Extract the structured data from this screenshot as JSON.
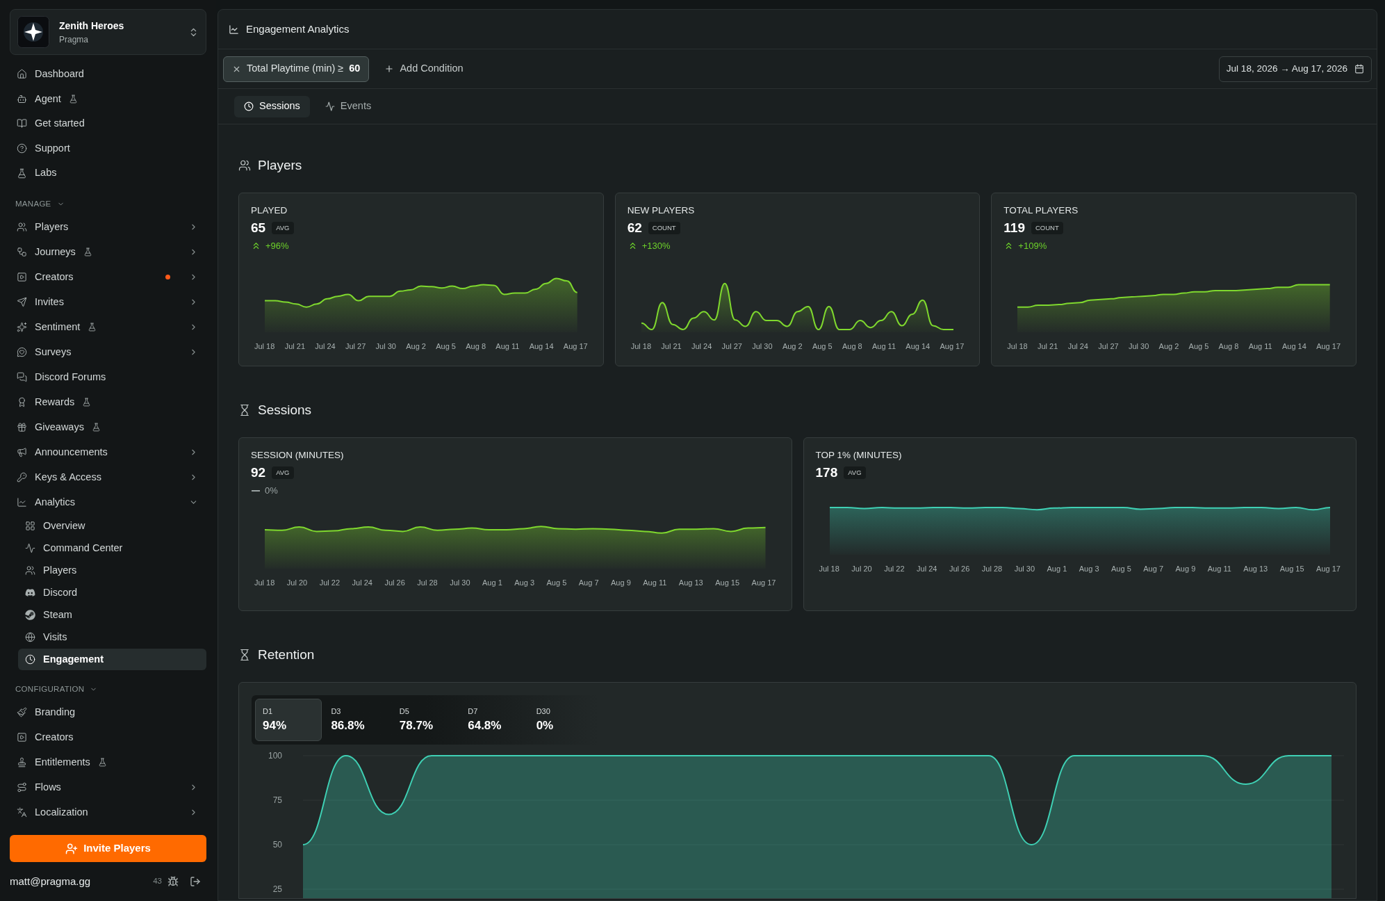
{
  "sidebar": {
    "workspace": {
      "name": "Zenith Heroes",
      "org": "Pragma"
    },
    "items": [
      {
        "label": "Dashboard",
        "beta": false
      },
      {
        "label": "Agent",
        "beta": true
      },
      {
        "label": "Get started",
        "beta": false
      },
      {
        "label": "Support",
        "beta": false
      },
      {
        "label": "Labs",
        "beta": false
      }
    ],
    "sections": [
      {
        "label": "MANAGE",
        "expanded": true,
        "items": [
          {
            "label": "Players",
            "beta": false,
            "notification": false,
            "submenu": true,
            "expanded": false
          },
          {
            "label": "Journeys",
            "beta": true,
            "notification": false,
            "submenu": true,
            "expanded": false
          },
          {
            "label": "Creators",
            "beta": false,
            "notification": true,
            "submenu": true,
            "expanded": false
          },
          {
            "label": "Invites",
            "beta": false,
            "notification": false,
            "submenu": true,
            "expanded": false
          },
          {
            "label": "Sentiment",
            "beta": true,
            "notification": false,
            "submenu": true,
            "expanded": false
          },
          {
            "label": "Surveys",
            "beta": false,
            "notification": false,
            "submenu": true,
            "expanded": false
          },
          {
            "label": "Discord Forums",
            "beta": false,
            "notification": false,
            "submenu": false,
            "expanded": false
          },
          {
            "label": "Rewards",
            "beta": true,
            "notification": false,
            "submenu": false,
            "expanded": false
          },
          {
            "label": "Giveaways",
            "beta": true,
            "notification": false,
            "submenu": false,
            "expanded": false
          },
          {
            "label": "Announcements",
            "beta": false,
            "notification": false,
            "submenu": true,
            "expanded": false
          },
          {
            "label": "Keys & Access",
            "beta": false,
            "notification": false,
            "submenu": true,
            "expanded": false
          },
          {
            "label": "Analytics",
            "beta": false,
            "notification": false,
            "submenu": true,
            "expanded": true,
            "children": [
              {
                "label": "Overview",
                "selected": false
              },
              {
                "label": "Command Center",
                "selected": false
              },
              {
                "label": "Players",
                "selected": false
              },
              {
                "label": "Discord",
                "selected": false
              },
              {
                "label": "Steam",
                "selected": false
              },
              {
                "label": "Visits",
                "selected": false
              },
              {
                "label": "Engagement",
                "selected": true
              }
            ]
          }
        ]
      },
      {
        "label": "CONFIGURATION",
        "expanded": true,
        "items": [
          {
            "label": "Branding",
            "beta": false,
            "notification": false,
            "submenu": false,
            "expanded": false
          },
          {
            "label": "Creators",
            "beta": false,
            "notification": false,
            "submenu": false,
            "expanded": false
          },
          {
            "label": "Entitlements",
            "beta": true,
            "notification": false,
            "submenu": false,
            "expanded": false
          },
          {
            "label": "Flows",
            "beta": false,
            "notification": false,
            "submenu": true,
            "expanded": false
          },
          {
            "label": "Localization",
            "beta": false,
            "notification": false,
            "submenu": true,
            "expanded": false
          }
        ]
      }
    ],
    "invite_button": "Invite Players",
    "user": {
      "email": "matt@pragma.gg",
      "count": "43"
    }
  },
  "header": {
    "title": "Engagement Analytics"
  },
  "filters": {
    "conditions": [
      {
        "label": "Total Playtime (min) ≥",
        "value": "60"
      }
    ],
    "add_button": "Add Condition",
    "date_range": "Jul 18, 2026 → Aug 17, 2026"
  },
  "tabs": [
    {
      "label": "Sessions",
      "selected": true
    },
    {
      "label": "Events",
      "selected": false
    }
  ],
  "sections": [
    {
      "title": "Players",
      "cards": [
        {
          "title": "PLAYED",
          "value": "65",
          "unit": "AVG",
          "color": "#7fd82e",
          "change": {
            "kind": "up",
            "text": "+96%"
          },
          "x_labels": [
            "Jul 18",
            "Jul 21",
            "Jul 24",
            "Jul 27",
            "Jul 30",
            "Aug 2",
            "Aug 5",
            "Aug 8",
            "Aug 11",
            "Aug 14",
            "Aug 17"
          ]
        },
        {
          "title": "NEW PLAYERS",
          "value": "62",
          "unit": "COUNT",
          "color": "#7fd82e",
          "change": {
            "kind": "up",
            "text": "+130%"
          },
          "x_labels": [
            "Jul 18",
            "Jul 21",
            "Jul 24",
            "Jul 27",
            "Jul 30",
            "Aug 2",
            "Aug 5",
            "Aug 8",
            "Aug 11",
            "Aug 14",
            "Aug 17"
          ]
        },
        {
          "title": "TOTAL PLAYERS",
          "value": "119",
          "unit": "COUNT",
          "color": "#7fd82e",
          "change": {
            "kind": "up",
            "text": "+109%"
          },
          "x_labels": [
            "Jul 18",
            "Jul 21",
            "Jul 24",
            "Jul 27",
            "Jul 30",
            "Aug 2",
            "Aug 5",
            "Aug 8",
            "Aug 11",
            "Aug 14",
            "Aug 17"
          ]
        }
      ]
    },
    {
      "title": "Sessions",
      "cards": [
        {
          "title": "SESSION (MINUTES)",
          "value": "92",
          "unit": "AVG",
          "color": "#7fd82e",
          "change": {
            "kind": "flat",
            "text": "0%"
          },
          "x_labels": [
            "Jul 18",
            "Jul 20",
            "Jul 22",
            "Jul 24",
            "Jul 26",
            "Jul 28",
            "Jul 30",
            "Aug 1",
            "Aug 3",
            "Aug 5",
            "Aug 7",
            "Aug 9",
            "Aug 11",
            "Aug 13",
            "Aug 15",
            "Aug 17"
          ]
        },
        {
          "title": "TOP 1% (MINUTES)",
          "value": "178",
          "unit": "AVG",
          "color": "#3fd0b4",
          "x_labels": [
            "Jul 18",
            "Jul 20",
            "Jul 22",
            "Jul 24",
            "Jul 26",
            "Jul 28",
            "Jul 30",
            "Aug 1",
            "Aug 3",
            "Aug 5",
            "Aug 7",
            "Aug 9",
            "Aug 11",
            "Aug 13",
            "Aug 15",
            "Aug 17"
          ]
        }
      ]
    }
  ],
  "retention": {
    "title": "Retention",
    "tabs": [
      {
        "label": "D1",
        "value": "94%",
        "selected": true
      },
      {
        "label": "D3",
        "value": "86.8%",
        "selected": false
      },
      {
        "label": "D5",
        "value": "78.7%",
        "selected": false
      },
      {
        "label": "D7",
        "value": "64.8%",
        "selected": false
      },
      {
        "label": "D30",
        "value": "0%",
        "selected": false
      }
    ],
    "chart_data": {
      "type": "area",
      "ylim": [
        20,
        100
      ],
      "grid": true,
      "yticks": [
        25,
        50,
        75,
        100
      ],
      "series": [
        {
          "color": "#3fd0b4",
          "values": [
            50,
            100,
            67,
            100,
            100,
            100,
            100,
            100,
            100,
            100,
            100,
            100,
            100,
            100,
            100,
            100,
            100,
            50,
            100,
            100,
            100,
            100,
            84,
            100,
            100
          ]
        }
      ]
    }
  }
}
